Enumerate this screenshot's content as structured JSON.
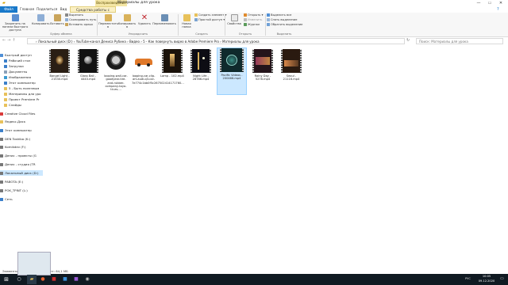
{
  "window": {
    "context_tab": "Воспроизведение",
    "title": "Материалы для урока",
    "min_glyph": "—",
    "max_glyph": "☐",
    "close_glyph": "✕"
  },
  "tabs": [
    "Файл",
    "Главная",
    "Поделиться",
    "Вид",
    "Средства работы с видео"
  ],
  "ribbon": {
    "pin": "Закрепить на панели быстрого доступа",
    "copy": "Копировать",
    "paste": "Вставить",
    "cut": "Вырезать",
    "copy_path": "Скопировать путь",
    "paste_shortcut": "Вставить ярлык",
    "move_to": "Переместить в",
    "copy_to": "Копировать в",
    "delete": "Удалить",
    "rename": "Переименовать",
    "new_folder": "Новая папка",
    "new_item": "Создать элемент",
    "easy_access": "Простой доступ",
    "properties": "Свойства",
    "open": "Открыть",
    "edit": "Изменить",
    "history": "Журнал",
    "select_all": "Выделить все",
    "select_none": "Снять выделение",
    "invert_selection": "Обратить выделение",
    "groups": [
      "Буфер обмена",
      "Упорядочить",
      "Создать",
      "Открыть",
      "Выделить"
    ]
  },
  "address": {
    "path": "›  Локальный диск (D:)  ›  YouTube-канал Дениса Рубина  ›  Видео  ›  5 - Как повернуть видео в Adobe Premiere Pro  ›  Материалы для урока",
    "search_placeholder": "Поиск: Материалы для урока"
  },
  "sidebar": [
    "Быстрый доступ",
    "Рабочий стол",
    "Загрузки",
    "Документы",
    "Изображения",
    "Этот компьютер",
    "5 - Быть полезным",
    "Материалы для уро",
    "Проект Premiere Pr",
    "Слайды",
    "Creative Cloud Files",
    "Яндекс.Диск",
    "Этот компьютер",
    "DEN Toshiba (K:)",
    "Komikdev (F:)",
    "Денис - проекты (G",
    "Денис - студия (TR",
    "Локальный диск (D:)",
    "PABOTA (E:)",
    "POK_TPINT (L:)",
    "Сеть"
  ],
  "files": [
    {
      "name": "Bangel Light - 21530.mp4",
      "icon": "video-thumb-dark"
    },
    {
      "name": "Glass Ball - 4443.mp4",
      "icon": "video-thumb-dark"
    },
    {
      "name": "looping-wall-car-goodyear-tire-and-rubber-company-toyo-tir-es....",
      "icon": "tire-thumb"
    },
    {
      "name": "looping-car-clip-art-audi-q3-car-7e774c1bb0f5c267502414171760...",
      "icon": "car-thumb"
    },
    {
      "name": "Lamp - 102.mp4",
      "icon": "video-thumb-dark"
    },
    {
      "name": "Night Life - 28786.mp4",
      "icon": "video-thumb-dark"
    },
    {
      "name": "Pacific Videos - 200466.mp4",
      "icon": "video-thumb-teal"
    },
    {
      "name": "Rainy Day - 5278.mp4",
      "icon": "video-thumb-dark"
    },
    {
      "name": "Seoul - 21116.mp4",
      "icon": "video-thumb-dark"
    }
  ],
  "status": "Элементов: 9    Выбран 1 элемент: 64,1 МБ",
  "tray": {
    "time": "10:05",
    "date": "09.12.2020",
    "lang": "РУС"
  }
}
